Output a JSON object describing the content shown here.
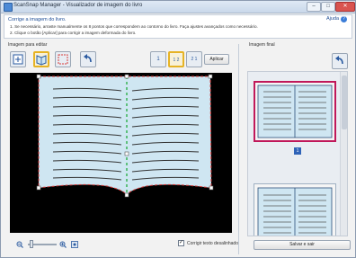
{
  "window": {
    "title": "ScanSnap Manager - Visualizador de imagem do livro",
    "min_label": "–",
    "max_label": "□",
    "close_label": "✕"
  },
  "instructions": {
    "title": "Corrige a imagem do livro.",
    "line1": "1. Se necessário, arraste manualmente os 8 pontos que correspondem ao contorno do livro. Faça ajustes avançados como necessário.",
    "line2": "2. Clique o botão [Aplicar] para corrigir a imagem deformada do livro.",
    "help_label": "Ajuda",
    "help_icon": "?"
  },
  "left_pane": {
    "label": "Imagem para editar"
  },
  "right_pane": {
    "label": "Imagem final",
    "page_number": "1"
  },
  "toolbar": {
    "mode1": "1",
    "mode12": "1 2",
    "mode21": "2 1",
    "apply_label": "Aplicar"
  },
  "bottom": {
    "checkbox_label": "Corrigir texto desalinhado",
    "checkbox_mark": "✓",
    "save_label": "Salvar e sair"
  },
  "icons": {
    "select": "select-icon",
    "book_crop": "book-crop-icon",
    "area_select": "area-select-icon",
    "rotate_left": "rotate-left-icon",
    "zoom_out": "zoom-out-icon",
    "zoom_in": "zoom-in-icon",
    "fit": "fit-icon",
    "rotate_right": "rotate-right-icon"
  },
  "colors": {
    "page_fill": "#cfe6f2",
    "contour_red": "#d83a3a",
    "spine_green": "#2fb04a",
    "selected_thumb": "#c0185a",
    "accent": "#2f63b8"
  }
}
